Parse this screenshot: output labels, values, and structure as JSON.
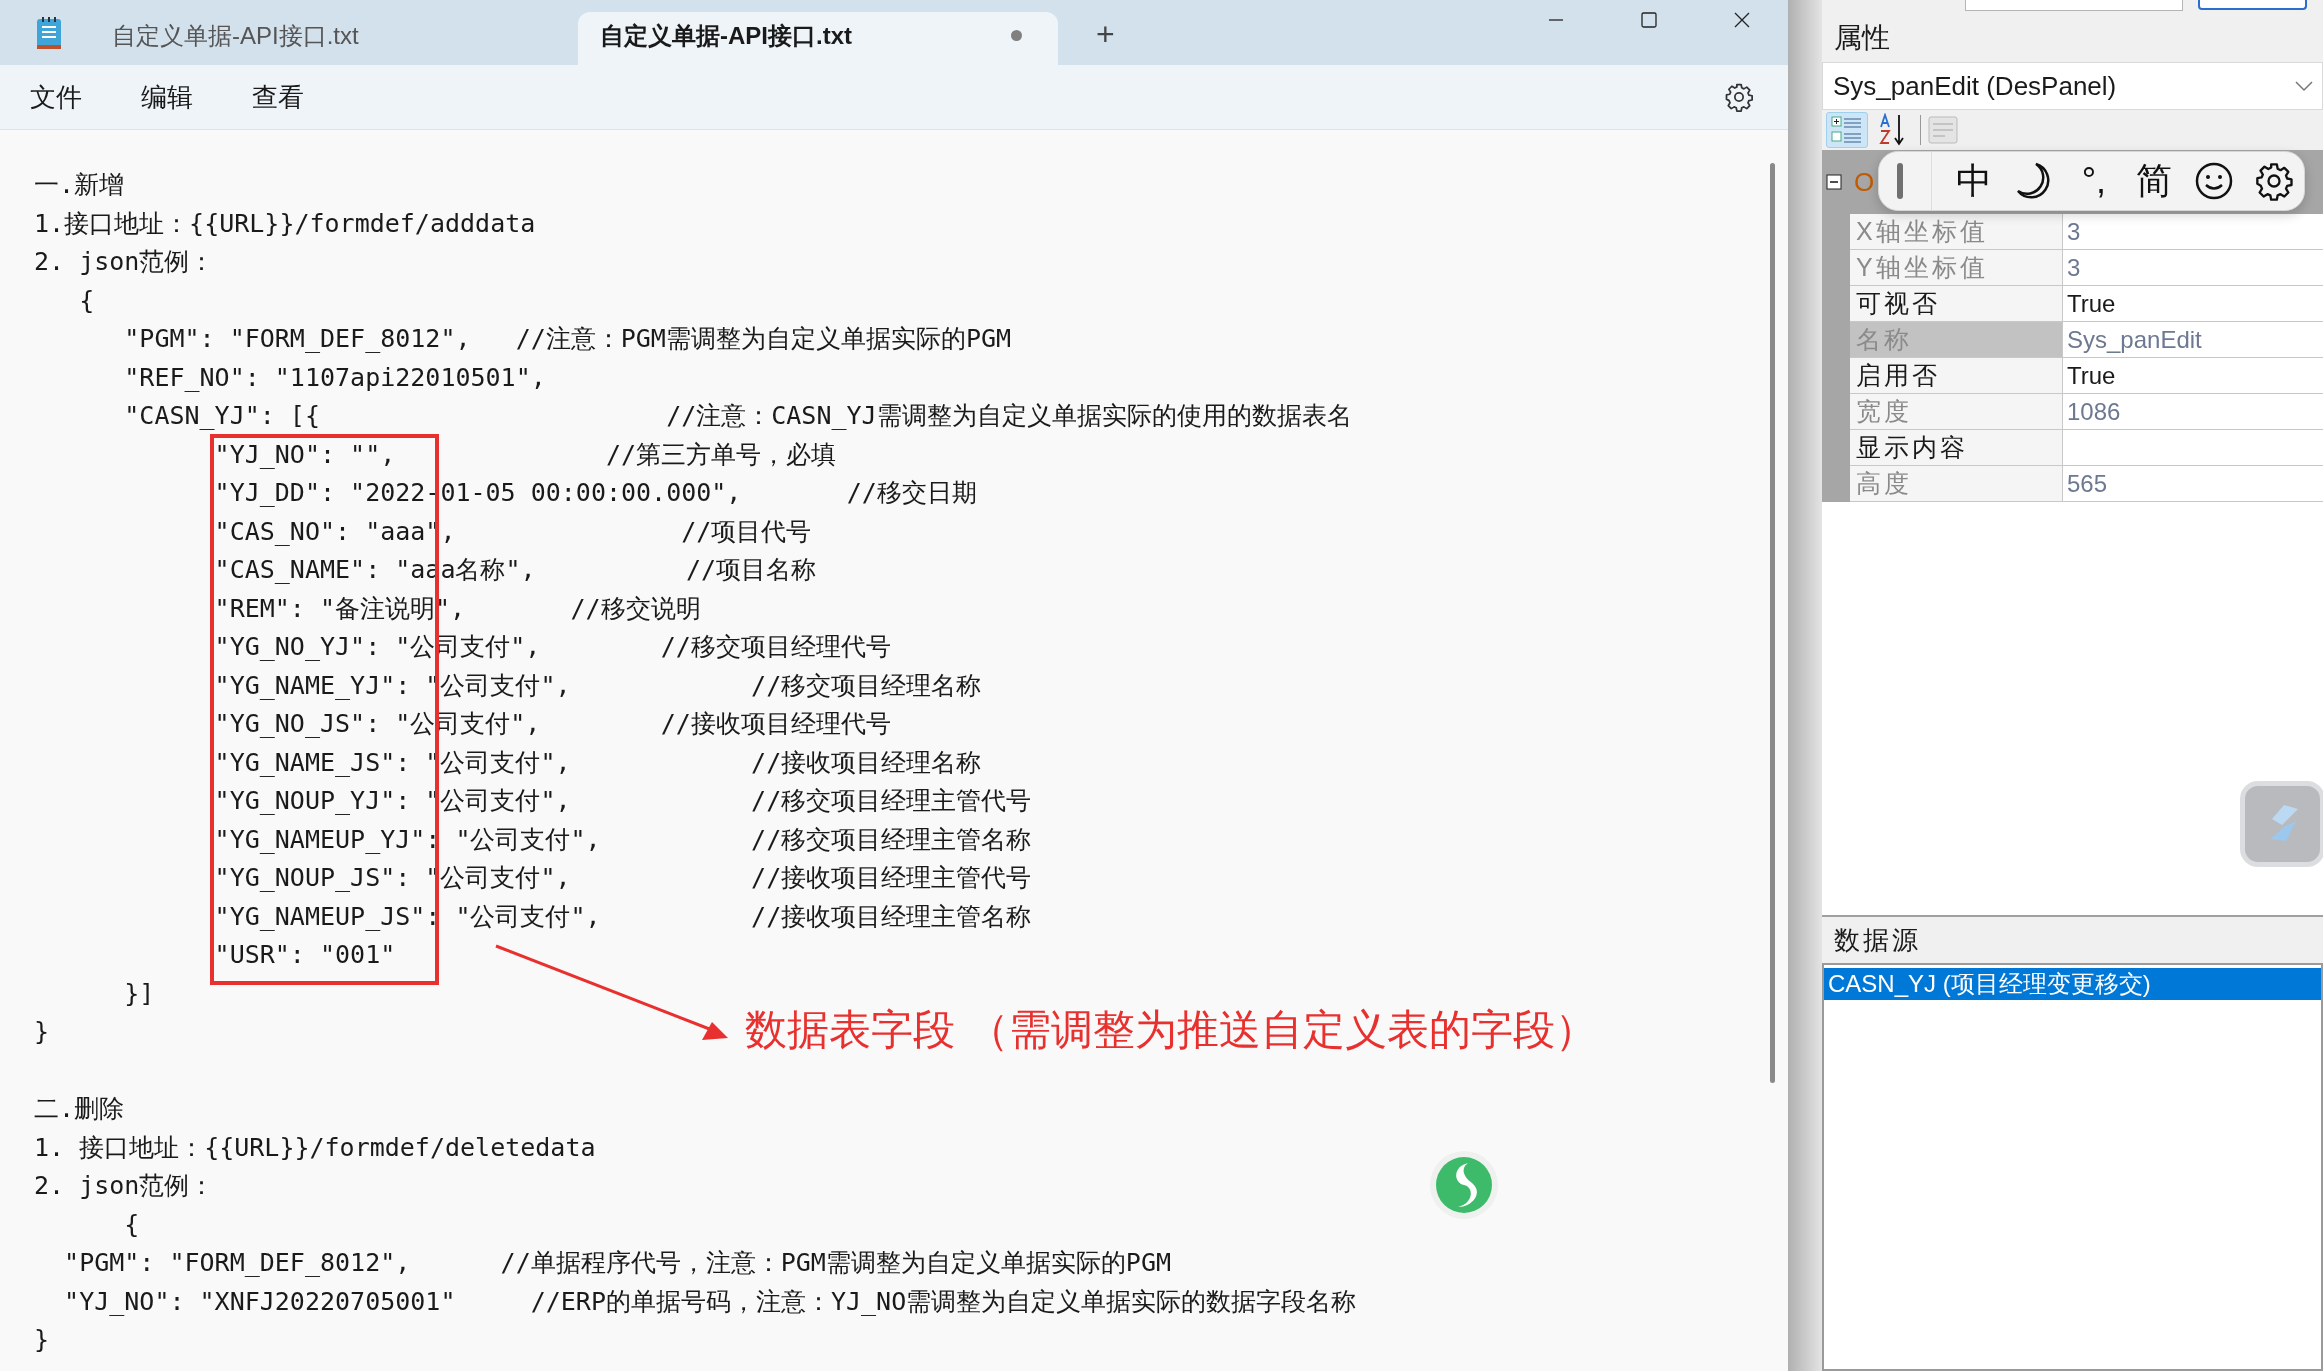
{
  "window": {
    "tabs": [
      {
        "title": "自定义单据-API接口.txt",
        "selected": false,
        "modified": false
      },
      {
        "title": "自定义单据-API接口.txt",
        "selected": true,
        "modified": true
      }
    ],
    "new_tab": "+"
  },
  "menu": [
    {
      "label": "文件"
    },
    {
      "label": "编辑"
    },
    {
      "label": "查看"
    }
  ],
  "document": {
    "sections": [
      {
        "lines": [
          "一.新增",
          "1.接口地址：{{URL}}/formdef/adddata",
          "2. json范例：",
          "   {",
          "      \"PGM\": \"FORM_DEF_8012\",   //注意：PGM需调整为自定义单据实际的PGM",
          "      \"REF_NO\": \"1107api22010501\",",
          "      \"CASN_YJ\": [{                       //注意：CASN_YJ需调整为自定义单据实际的使用的数据表名",
          "            \"YJ_NO\": \"\",              //第三方单号，必填",
          "            \"YJ_DD\": \"2022-01-05 00:00:00.000\",       //移交日期",
          "            \"CAS_NO\": \"aaa\",               //项目代号",
          "            \"CAS_NAME\": \"aaa名称\",          //项目名称",
          "            \"REM\": \"备注说明\",       //移交说明",
          "            \"YG_NO_YJ\": \"公司支付\",        //移交项目经理代号",
          "            \"YG_NAME_YJ\": \"公司支付\",            //移交项目经理名称",
          "            \"YG_NO_JS\": \"公司支付\",        //接收项目经理代号",
          "            \"YG_NAME_JS\": \"公司支付\",            //接收项目经理名称",
          "            \"YG_NOUP_YJ\": \"公司支付\",            //移交项目经理主管代号",
          "            \"YG_NAMEUP_YJ\": \"公司支付\",          //移交项目经理主管名称",
          "            \"YG_NOUP_JS\": \"公司支付\",            //接收项目经理主管代号",
          "            \"YG_NAMEUP_JS\": \"公司支付\",          //接收项目经理主管名称",
          "            \"USR\": \"001\"",
          "      }]",
          "}"
        ]
      },
      {
        "lines": [
          "二.删除",
          "1. 接口地址：{{URL}}/formdef/deletedata",
          "2. json范例：",
          "      {",
          "  \"PGM\": \"FORM_DEF_8012\",      //单据程序代号，注意：PGM需调整为自定义单据实际的PGM",
          "  \"YJ_NO\": \"XNFJ20220705001\"     //ERP的单据号码，注意：YJ_NO需调整为自定义单据实际的数据字段名称",
          "}"
        ]
      }
    ]
  },
  "annotation": {
    "text": "数据表字段 （需调整为推送自定义表的字段）"
  },
  "properties": {
    "title": "属性",
    "object": "Sys_panEdit (DesPanel)",
    "toolbar": [
      {
        "kind": "categorized",
        "selected": true
      },
      {
        "kind": "alphabetical",
        "selected": false
      }
    ],
    "category": "O",
    "rows": [
      {
        "label": "X轴坐标值",
        "value": "3",
        "readonly": true,
        "selected": false
      },
      {
        "label": "Y轴坐标值",
        "value": "3",
        "readonly": true,
        "selected": false
      },
      {
        "label": "可视否",
        "value": "True",
        "readonly": false,
        "selected": false
      },
      {
        "label": "名称",
        "value": "Sys_panEdit",
        "readonly": true,
        "selected": true
      },
      {
        "label": "启用否",
        "value": "True",
        "readonly": false,
        "selected": false
      },
      {
        "label": "宽度",
        "value": "1086",
        "readonly": true,
        "selected": false
      },
      {
        "label": "显示内容",
        "readonly": false,
        "selected": false
      },
      {
        "label": "高度",
        "value": "565",
        "readonly": true,
        "selected": false
      }
    ]
  },
  "ime_bar": {
    "items": [
      {
        "kind": "text",
        "label": "中"
      },
      {
        "kind": "moon"
      },
      {
        "kind": "text",
        "label": "°,"
      },
      {
        "kind": "text",
        "label": "简"
      },
      {
        "kind": "smiley"
      },
      {
        "kind": "gear"
      }
    ]
  },
  "datasource": {
    "title": "数据源",
    "items": [
      {
        "label": "CASN_YJ (项目经理变更移交)",
        "selected": true
      }
    ]
  }
}
